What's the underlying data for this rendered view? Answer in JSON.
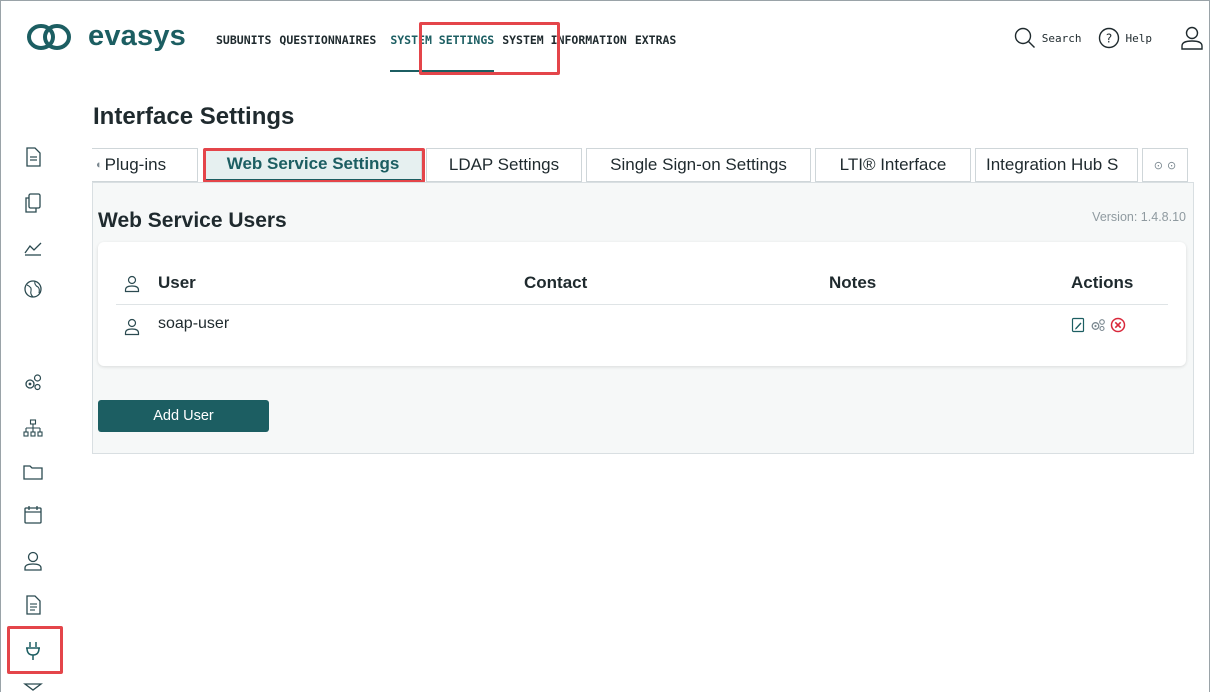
{
  "brand": "evasys",
  "nav": {
    "items": [
      "SUBUNITS",
      "QUESTIONNAIRES",
      "SYSTEM SETTINGS",
      "SYSTEM INFORMATION",
      "EXTRAS"
    ],
    "active": "SYSTEM SETTINGS"
  },
  "top_right": {
    "search_label": "Search",
    "help_label": "Help"
  },
  "page": {
    "title": "Interface Settings"
  },
  "tabs": [
    {
      "label": "Plug-ins",
      "active": false
    },
    {
      "label": "Web Service Settings",
      "active": true
    },
    {
      "label": "LDAP Settings",
      "active": false
    },
    {
      "label": "Single Sign-on Settings",
      "active": false
    },
    {
      "label": "LTI® Interface",
      "active": false
    },
    {
      "label": "Integration Hub S",
      "active": false
    }
  ],
  "section": {
    "title": "Web Service Users",
    "version": "Version: 1.4.8.10"
  },
  "table": {
    "columns": [
      "User",
      "Contact",
      "Notes",
      "Actions"
    ],
    "rows": [
      {
        "user": "soap-user",
        "contact": "",
        "notes": ""
      }
    ]
  },
  "add_user_label": "Add User",
  "colors": {
    "brand": "#1c5e62",
    "highlight": "#e4454a",
    "delete": "#d9283b"
  },
  "sidebar_icons": [
    "document-icon",
    "copy-icon",
    "chart-icon",
    "globe-icon",
    "gears-icon",
    "hierarchy-icon",
    "folder-icon",
    "calendar-icon",
    "user-icon",
    "report-icon",
    "plug-icon",
    "mail-icon"
  ]
}
